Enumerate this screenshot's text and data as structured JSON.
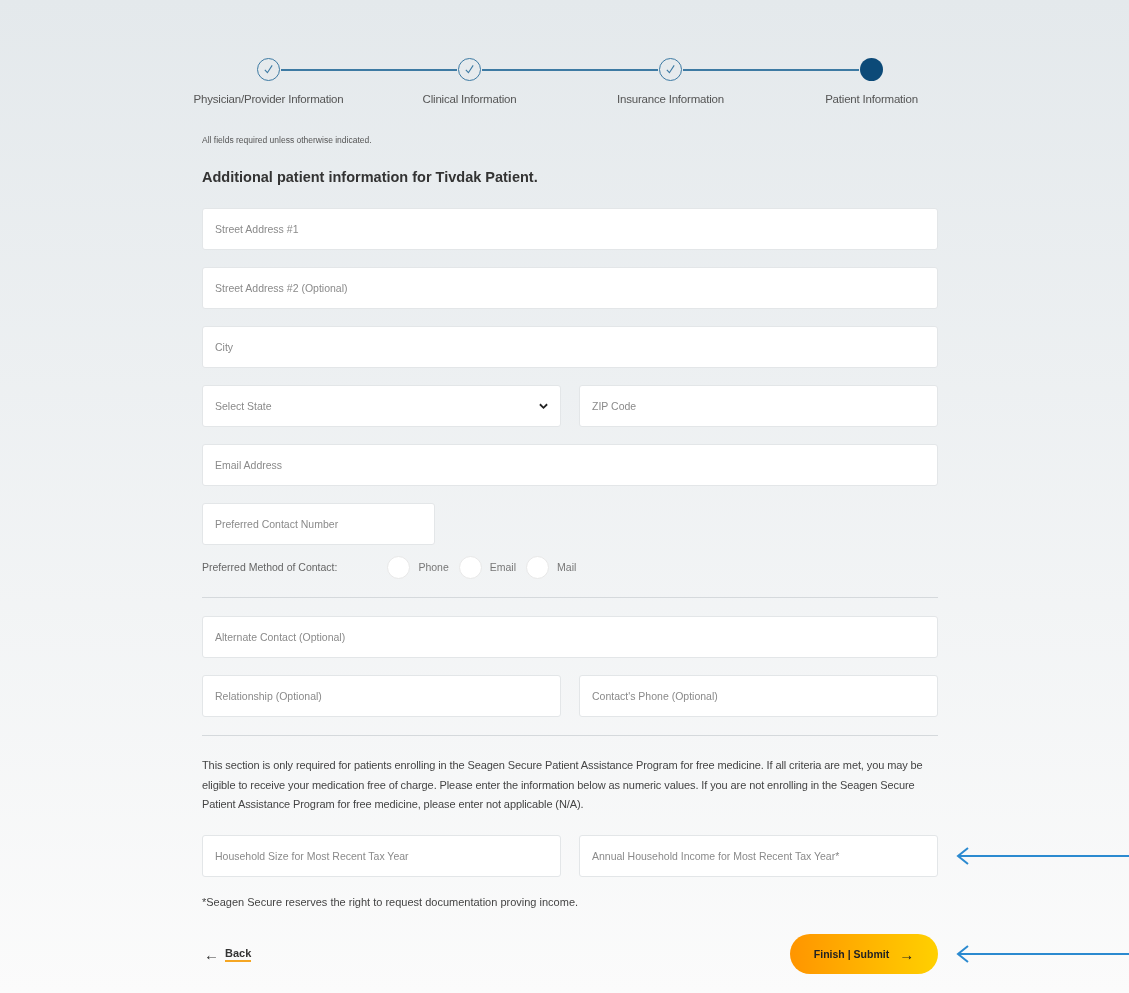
{
  "steps": [
    {
      "label": "Physician/Provider Information",
      "completed": true
    },
    {
      "label": "Clinical Information",
      "completed": true
    },
    {
      "label": "Insurance Information",
      "completed": true
    },
    {
      "label": "Patient Information",
      "completed": false
    }
  ],
  "required_note": "All fields required unless otherwise indicated.",
  "heading": "Additional patient information for Tivdak Patient.",
  "address_rows": [
    [
      {
        "kind": "text",
        "placeholder": "Street Address #1"
      }
    ],
    [
      {
        "kind": "text",
        "placeholder": "Street Address #2 (Optional)"
      }
    ],
    [
      {
        "kind": "text",
        "placeholder": "City"
      }
    ],
    [
      {
        "kind": "select",
        "placeholder": "Select State"
      },
      {
        "kind": "text",
        "placeholder": "ZIP Code"
      }
    ],
    [
      {
        "kind": "text",
        "placeholder": "Email Address"
      }
    ],
    [
      {
        "kind": "short",
        "placeholder": "Preferred Contact Number"
      }
    ]
  ],
  "contact_method": {
    "label": "Preferred Method of Contact:",
    "options": [
      {
        "label": "Phone",
        "selected": false
      },
      {
        "label": "Email",
        "selected": false
      },
      {
        "label": "Mail",
        "selected": false
      }
    ]
  },
  "alternate_rows": [
    [
      {
        "kind": "text",
        "placeholder": "Alternate Contact (Optional)"
      }
    ],
    [
      {
        "kind": "text",
        "placeholder": "Relationship (Optional)"
      },
      {
        "kind": "text",
        "placeholder": "Contact's Phone (Optional)"
      }
    ]
  ],
  "assistance_text": "This section is only required for patients enrolling in the Seagen Secure Patient Assistance Program for free medicine. If all criteria are met, you may be eligible to receive your medication free of charge. Please enter the information below as numeric values. If you are not enrolling in the Seagen Secure Patient Assistance Program for free medicine, please enter not applicable (N/A).",
  "income_row": {
    "annotated": true,
    "fields": [
      {
        "kind": "text",
        "placeholder": "Household Size for Most Recent Tax Year"
      },
      {
        "kind": "text",
        "placeholder": "Annual Household Income for Most Recent Tax Year*"
      }
    ]
  },
  "footnote": "*Seagen Secure reserves the right to request documentation proving income.",
  "actions": {
    "annotated": true,
    "back": {
      "arrow": "←",
      "label": "Back"
    },
    "submit": {
      "label": "Finish | Submit",
      "arrow": "→"
    }
  }
}
